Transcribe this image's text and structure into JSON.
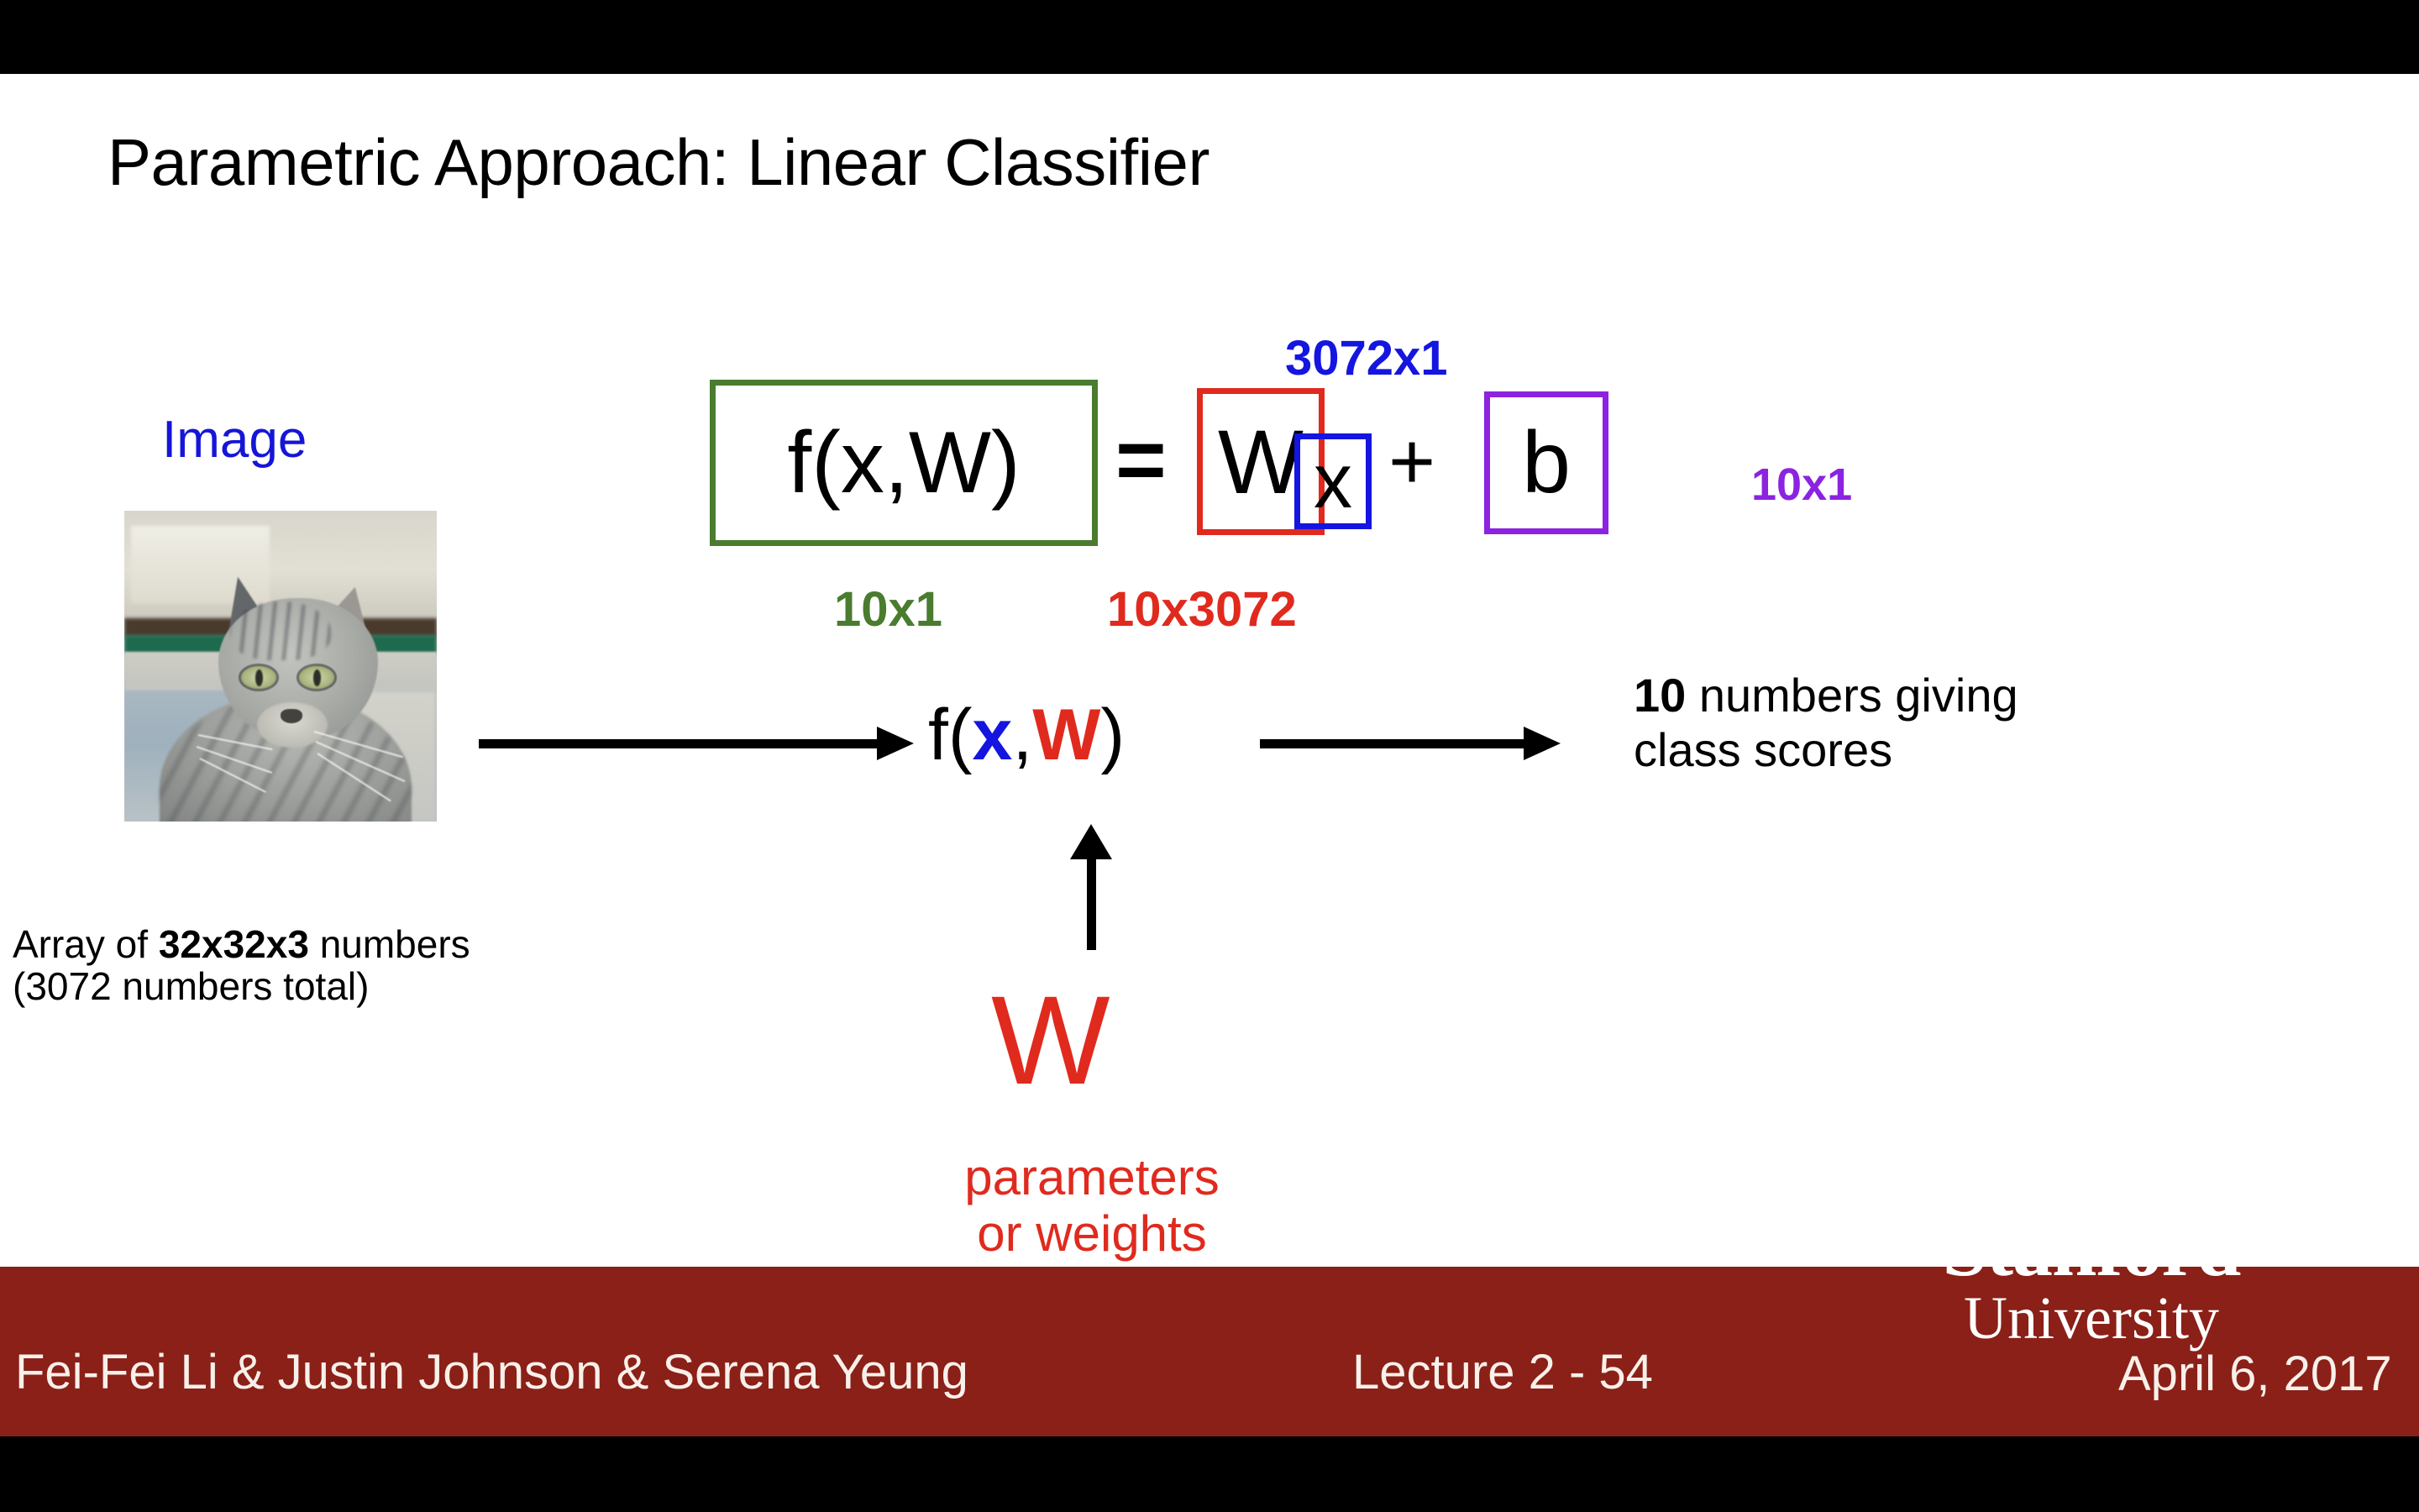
{
  "slide": {
    "title": "Parametric Approach: Linear Classifier",
    "image_label": "Image",
    "array_caption_line1_pre": "Array of ",
    "array_caption_line1_bold": "32x32x3",
    "array_caption_line1_post": " numbers",
    "array_caption_line2": "(3072 numbers total)",
    "equation": {
      "fxw": "f(x,W)",
      "equals": "=",
      "weight_symbol": "W",
      "input_symbol": "x",
      "plus": "+",
      "bias_symbol": "b",
      "dim_fxw": "10x1",
      "dim_weight": "10x3072",
      "dim_input": "3072x1",
      "dim_bias": "10x1"
    },
    "flow": {
      "fxw_f": "f(",
      "fxw_x": "x",
      "fxw_comma": ",",
      "fxw_W": "W",
      "fxw_close": ")",
      "scores_bold": "10",
      "scores_rest": " numbers giving",
      "scores_line2": "class scores"
    },
    "weights": {
      "symbol": "W",
      "caption_line1": "parameters",
      "caption_line2": "or weights"
    }
  },
  "logo": {
    "name": "Stanford",
    "university": "University"
  },
  "footer": {
    "authors": "Fei-Fei Li & Justin Johnson & Serena Yeung",
    "lecture": "Lecture 2 -  54",
    "date": "April 6, 2017"
  },
  "colors": {
    "green_box": "#4a7c2f",
    "red_box": "#e02a1e",
    "blue_box": "#1515e0",
    "purple_box": "#8b23e0",
    "footer_band": "#8a2017",
    "slide_background": "#ffffff",
    "letterbox": "#000000"
  }
}
